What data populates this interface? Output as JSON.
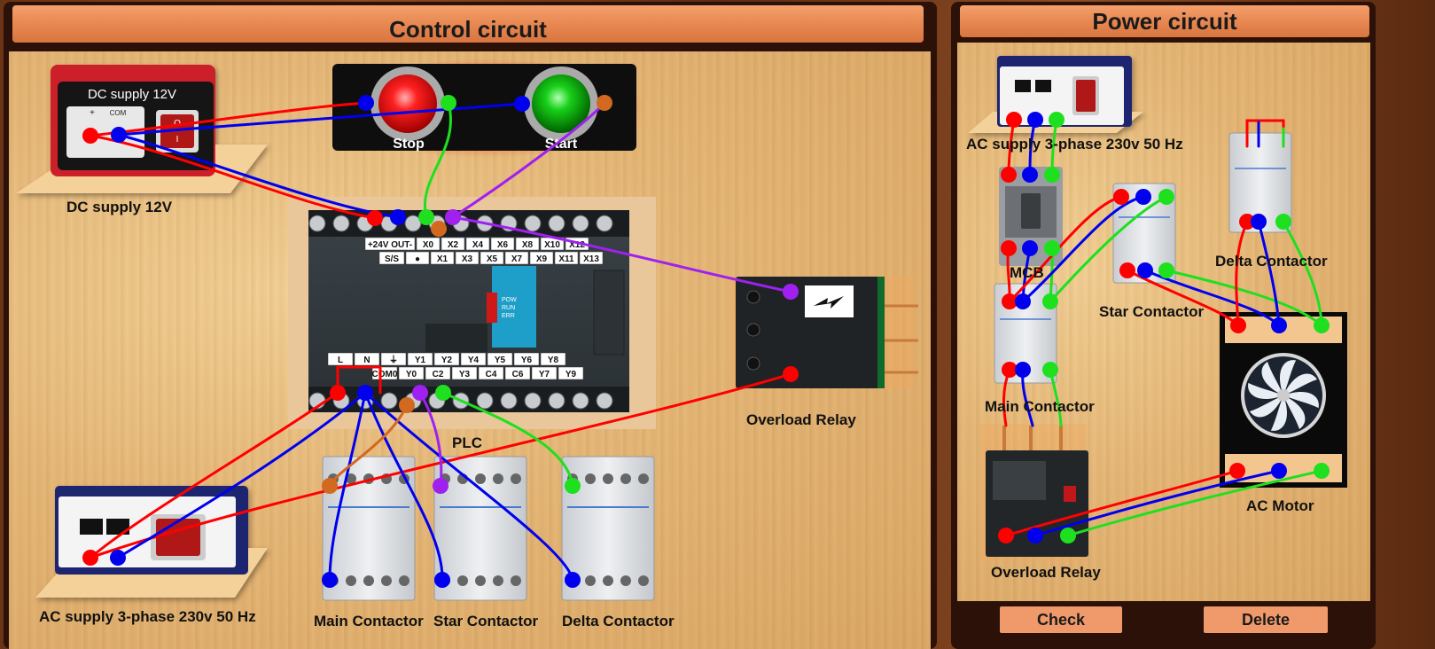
{
  "control": {
    "title": "Control circuit",
    "labels": {
      "dc_supply": "DC supply 12V",
      "ac_supply": "AC supply 3-phase 230v 50 Hz",
      "plc": "PLC",
      "overload_relay": "Overload Relay",
      "main_contactor": "Main Contactor",
      "star_contactor": "Star Contactor",
      "delta_contactor": "Delta Contactor",
      "stop": "Stop",
      "start": "Start"
    },
    "dc_device": {
      "title": "DC supply 12V",
      "plus": "+",
      "com": "COM"
    },
    "plc_terminals": {
      "top_row1": [
        "+24V OUT-",
        "X0",
        "X2",
        "X4",
        "X6",
        "X8",
        "X10",
        "X12"
      ],
      "top_row2": [
        "S/S",
        "●",
        "X1",
        "X3",
        "X5",
        "X7",
        "X9",
        "X11",
        "X13"
      ],
      "bottom_row1": [
        "L",
        "N",
        "⏚",
        "Y1",
        "Y2",
        "Y4",
        "Y5",
        "Y6",
        "Y8"
      ],
      "bottom_row2": [
        "COM0",
        "Y0",
        "C2",
        "Y3",
        "C4",
        "C6",
        "Y7",
        "Y9"
      ],
      "leds": [
        "POW",
        "RUN",
        "ERR"
      ]
    }
  },
  "power": {
    "title": "Power circuit",
    "labels": {
      "ac_supply": "AC supply 3-phase 230v 50 Hz",
      "mcb": "MCB",
      "star_contactor": "Star Contactor",
      "delta_contactor": "Delta Contactor",
      "main_contactor": "Main Contactor",
      "overload_relay": "Overload Relay",
      "ac_motor": "AC Motor"
    }
  },
  "buttons": {
    "check": "Check",
    "delete": "Delete"
  },
  "colors": {
    "wire_red": "#ff0000",
    "wire_blue": "#0000ee",
    "wire_green": "#1ee01e",
    "wire_purple": "#a020f0",
    "wire_orange": "#d2691e",
    "title_bar": "#e98a54",
    "button": "#f09a6b"
  }
}
